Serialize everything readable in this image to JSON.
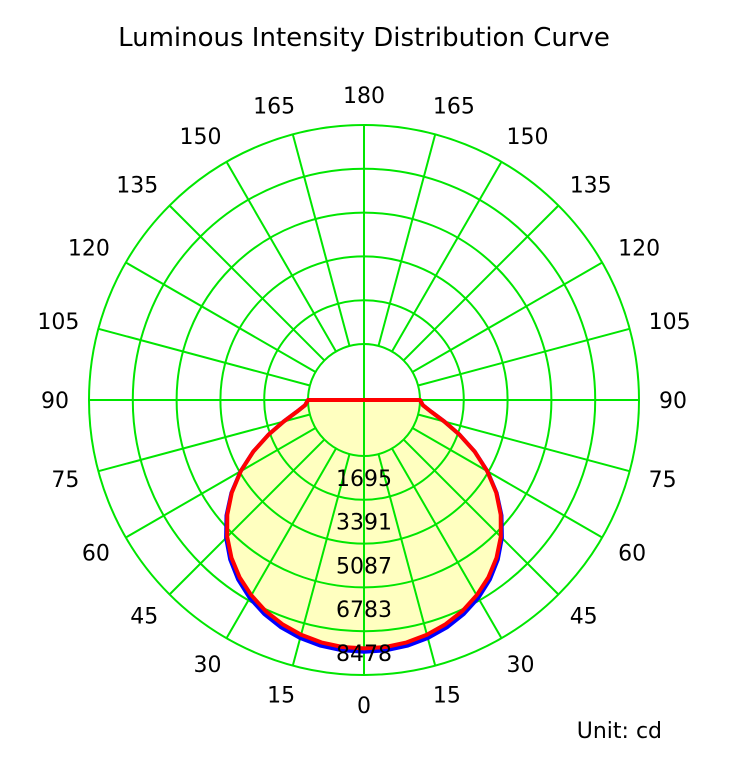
{
  "chart_data": {
    "type": "polar",
    "title": "Luminous Intensity Distribution Curve",
    "unit_label": "Unit: cd",
    "angle_labels_left": [
      "0",
      "15",
      "30",
      "45",
      "60",
      "75",
      "90",
      "105",
      "120",
      "135",
      "150",
      "165",
      "180"
    ],
    "angle_labels_right": [
      "15",
      "30",
      "45",
      "60",
      "75",
      "90",
      "105",
      "120",
      "135",
      "150",
      "165"
    ],
    "radial_ticks": [
      1695,
      3391,
      5087,
      6783,
      8478
    ],
    "radial_max": 8478,
    "grid": true,
    "colors": {
      "grid": "#00e600",
      "fill": "#ffffc0",
      "series_a": "#0000ff",
      "series_b": "#ff0000"
    },
    "series": [
      {
        "angles": [
          0,
          5,
          10,
          15,
          20,
          25,
          30,
          35,
          40,
          45,
          50,
          55,
          60,
          65,
          70,
          75,
          80,
          85,
          90
        ],
        "values": [
          7580,
          7560,
          7490,
          7370,
          7200,
          6970,
          6680,
          6320,
          5890,
          5380,
          4780,
          4100,
          3350,
          2560,
          1770,
          1050,
          480,
          120,
          0
        ]
      },
      {
        "angles": [
          0,
          5,
          10,
          15,
          20,
          25,
          30,
          35,
          40,
          45,
          50,
          55,
          60,
          65,
          70,
          75,
          80,
          85,
          90
        ],
        "values": [
          7450,
          7430,
          7360,
          7240,
          7070,
          6850,
          6560,
          6220,
          5810,
          5320,
          4740,
          4080,
          3340,
          2560,
          1770,
          1050,
          480,
          120,
          0
        ]
      }
    ]
  }
}
